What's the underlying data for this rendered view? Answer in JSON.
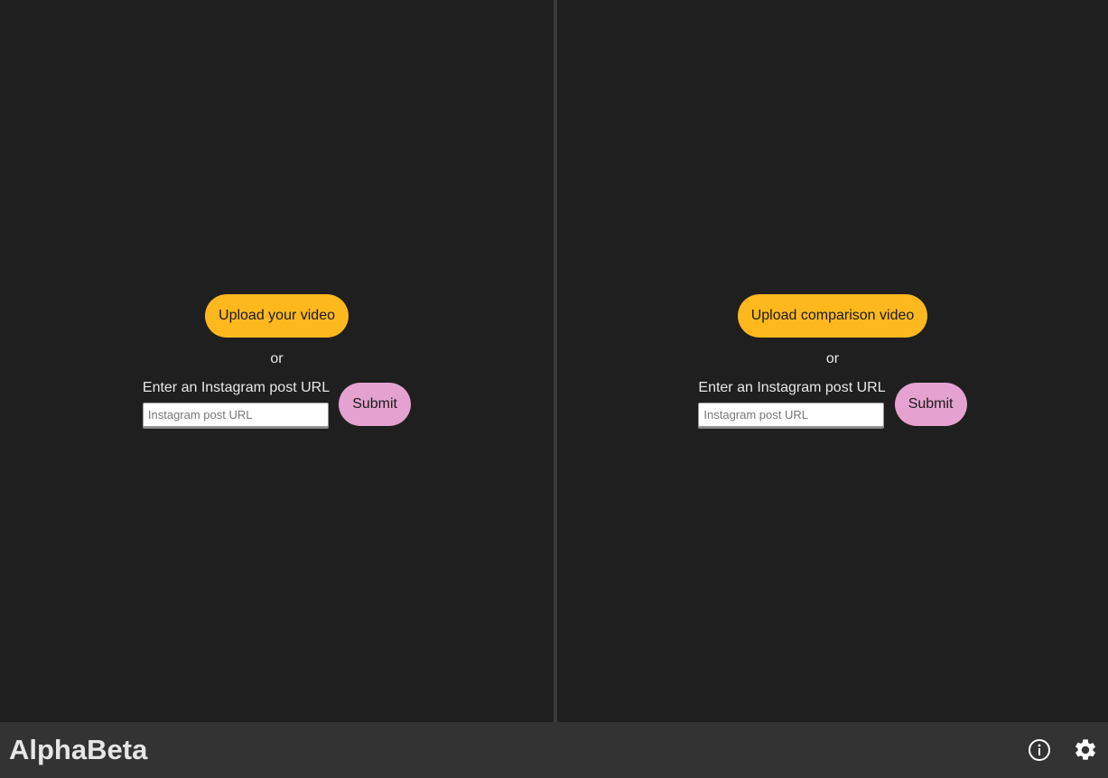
{
  "left_pane": {
    "upload_label": "Upload your video",
    "or_text": "or",
    "url_label": "Enter an Instagram post URL",
    "url_placeholder": "Instagram post URL",
    "url_value": "",
    "submit_label": "Submit"
  },
  "right_pane": {
    "upload_label": "Upload comparison video",
    "or_text": "or",
    "url_label": "Enter an Instagram post URL",
    "url_placeholder": "Instagram post URL",
    "url_value": "",
    "submit_label": "Submit"
  },
  "footer": {
    "brand": "AlphaBeta",
    "icons": [
      "info-icon",
      "gear-icon"
    ]
  },
  "colors": {
    "background": "#1f1f1f",
    "divider": "#3a3a3a",
    "footer": "#333333",
    "upload_button": "#fdb81e",
    "submit_button": "#e5a2d0"
  }
}
